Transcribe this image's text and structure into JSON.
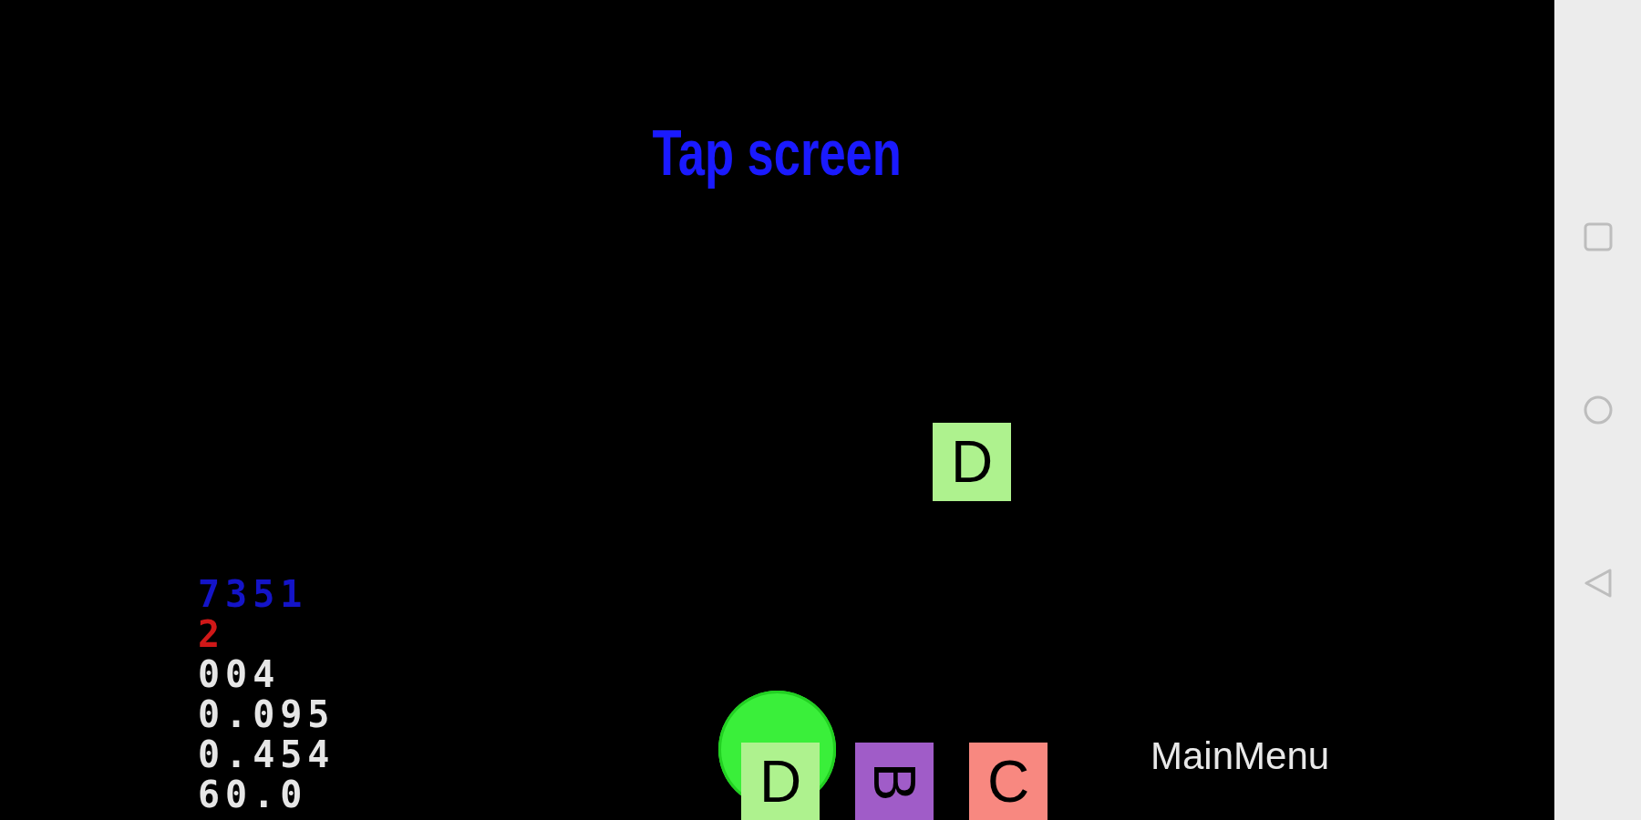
{
  "title": "Tap screen",
  "stats": [
    {
      "text": "7351",
      "color": "#1414c8"
    },
    {
      "text": "2",
      "color": "#d01818"
    },
    {
      "text": "004",
      "color": "#e6e6e6"
    },
    {
      "text": "0.095",
      "color": "#e6e6e6"
    },
    {
      "text": "0.454",
      "color": "#e6e6e6"
    },
    {
      "text": "60.0",
      "color": "#e6e6e6"
    }
  ],
  "board_tiles": [
    {
      "letter": "D",
      "color": "#aef28e"
    }
  ],
  "hand_tiles": [
    {
      "letter": "D",
      "color": "#aef28e",
      "rotated": false,
      "highlighted": true
    },
    {
      "letter": "B",
      "color": "#a05cc8",
      "rotated": true,
      "highlighted": false
    },
    {
      "letter": "C",
      "color": "#f88880",
      "rotated": false,
      "highlighted": false
    }
  ],
  "main_menu": {
    "label": "MainMenu"
  },
  "nav_bar": {
    "buttons": [
      {
        "kind": "recents"
      },
      {
        "kind": "home"
      },
      {
        "kind": "back"
      }
    ]
  }
}
